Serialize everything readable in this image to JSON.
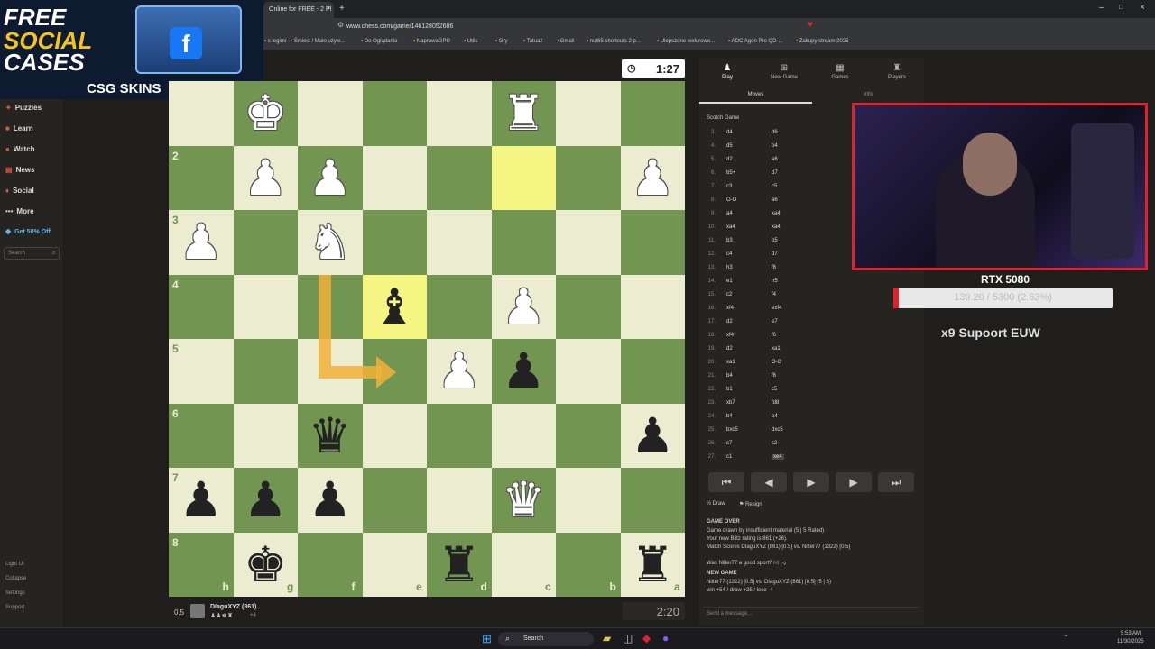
{
  "browser": {
    "tab_title": "Online for FREE - 2 Pl",
    "url": "www.chess.com/game/146128052686",
    "bookmarks": [
      "s legimi",
      "Śmieci / Mało używ...",
      "Do Oglądania",
      "NaprawaGPU",
      "Utils",
      "Gry",
      "Tatuaż",
      "Gmail",
      "nut65 shortcuts 2 p...",
      "Ulepszone wełurowe...",
      "AOC Agon Pro QD-...",
      "Zakupy stream 2025"
    ]
  },
  "promo": {
    "line1": "FREE",
    "line2": "SOCIAL",
    "line3": "CASES",
    "brand": "CSG SKINS",
    "box_label": "CSG SKINS"
  },
  "sidebar": {
    "items": [
      {
        "label": "Puzzles",
        "icon": "puzzle-icon"
      },
      {
        "label": "Learn",
        "icon": "learn-icon"
      },
      {
        "label": "Watch",
        "icon": "watch-icon"
      },
      {
        "label": "News",
        "icon": "news-icon"
      },
      {
        "label": "Social",
        "icon": "social-icon"
      },
      {
        "label": "More",
        "icon": "more-icon"
      },
      {
        "label": "Get 50% Off",
        "icon": "diamond-icon"
      }
    ],
    "search_placeholder": "Search",
    "bottom": [
      "Light UI",
      "Collapse",
      "Settings",
      "Support"
    ]
  },
  "board": {
    "rank_labels": [
      "2",
      "3",
      "4",
      "5",
      "6",
      "7",
      "8"
    ],
    "file_labels": [
      "h",
      "g",
      "f",
      "e",
      "d",
      "c",
      "b",
      "a"
    ],
    "pieces": [
      {
        "sq": [
          1,
          0
        ],
        "p": "♚",
        "c": "w"
      },
      {
        "sq": [
          5,
          0
        ],
        "p": "♜",
        "c": "w"
      },
      {
        "sq": [
          1,
          1
        ],
        "p": "♟",
        "c": "w"
      },
      {
        "sq": [
          2,
          1
        ],
        "p": "♟",
        "c": "w"
      },
      {
        "sq": [
          7,
          1
        ],
        "p": "♟",
        "c": "w"
      },
      {
        "sq": [
          0,
          2
        ],
        "p": "♟",
        "c": "w"
      },
      {
        "sq": [
          2,
          2
        ],
        "p": "♞",
        "c": "w"
      },
      {
        "sq": [
          3,
          3
        ],
        "p": "♝",
        "c": "b"
      },
      {
        "sq": [
          5,
          3
        ],
        "p": "♟",
        "c": "w"
      },
      {
        "sq": [
          4,
          4
        ],
        "p": "♟",
        "c": "w"
      },
      {
        "sq": [
          5,
          4
        ],
        "p": "♟",
        "c": "b"
      },
      {
        "sq": [
          2,
          5
        ],
        "p": "♛",
        "c": "b"
      },
      {
        "sq": [
          7,
          5
        ],
        "p": "♟",
        "c": "b"
      },
      {
        "sq": [
          0,
          6
        ],
        "p": "♟",
        "c": "b"
      },
      {
        "sq": [
          1,
          6
        ],
        "p": "♟",
        "c": "b"
      },
      {
        "sq": [
          2,
          6
        ],
        "p": "♟",
        "c": "b"
      },
      {
        "sq": [
          5,
          6
        ],
        "p": "♛",
        "c": "w"
      },
      {
        "sq": [
          1,
          7
        ],
        "p": "♚",
        "c": "b"
      },
      {
        "sq": [
          4,
          7
        ],
        "p": "♜",
        "c": "b"
      },
      {
        "sq": [
          7,
          7
        ],
        "p": "♜",
        "c": "b"
      }
    ],
    "highlights": [
      [
        5,
        1
      ],
      [
        3,
        3
      ]
    ]
  },
  "clock": {
    "top": "1:27",
    "bottom": "2:20"
  },
  "player_bottom": {
    "score": "0.5",
    "name": "DIaguXYZ (861)",
    "diff": "+4"
  },
  "panel": {
    "tabs": [
      {
        "label": "Play",
        "icon": "play-icon"
      },
      {
        "label": "New Game",
        "icon": "plus-icon"
      },
      {
        "label": "Games",
        "icon": "games-icon"
      },
      {
        "label": "Players",
        "icon": "players-icon"
      }
    ],
    "subtabs": [
      "Moves",
      "Info"
    ],
    "opening": "Scotch Game",
    "moves": [
      [
        "3.",
        "d4",
        "d6"
      ],
      [
        "4.",
        "d5",
        "b4"
      ],
      [
        "5.",
        "d2",
        "a6"
      ],
      [
        "6.",
        "b5+",
        "d7"
      ],
      [
        "7.",
        "c3",
        "c5"
      ],
      [
        "8.",
        "O-O",
        "a6"
      ],
      [
        "9.",
        "a4",
        "xa4"
      ],
      [
        "10.",
        "xa4",
        "xa4"
      ],
      [
        "11.",
        "b3",
        "b5"
      ],
      [
        "12.",
        "c4",
        "d7"
      ],
      [
        "13.",
        "h3",
        "f6"
      ],
      [
        "14.",
        "e1",
        "h5"
      ],
      [
        "15.",
        "c2",
        "f4"
      ],
      [
        "16.",
        "xf4",
        "exf4"
      ],
      [
        "17.",
        "d2",
        "e7"
      ],
      [
        "18.",
        "xf4",
        "f6"
      ],
      [
        "19.",
        "d2",
        "xa1"
      ],
      [
        "20.",
        "xa1",
        "O-O"
      ],
      [
        "21.",
        "b4",
        "f6"
      ],
      [
        "22.",
        "b1",
        "c5"
      ],
      [
        "23.",
        "xb7",
        "fd8"
      ],
      [
        "24.",
        "b4",
        "a4"
      ],
      [
        "25.",
        "bxc5",
        "dxc5"
      ],
      [
        "26.",
        "c7",
        "c2"
      ],
      [
        "27.",
        "c1",
        "xe4"
      ]
    ],
    "draw_label": "Draw",
    "resign_label": "Resign",
    "game_over_title": "GAME OVER",
    "game_over_lines": [
      "Game drawn by insufficient material (5 | 5 Rated)",
      "Your new Blitz rating is 861 (+26).",
      "Match Scores DIaguXYZ (861) [0.5] vs. Nilter77 (1322) [0.5]"
    ],
    "sportsmanship": "Was Nilter77 a good sport?",
    "new_game_title": "NEW GAME",
    "new_game_lines": [
      "Nilter77 (1322) [0.5] vs. DIaguXYZ (861) [0.5] (5 | 5)",
      "win +54 / draw +25 / lose -4"
    ],
    "chat_placeholder": "Send a message..."
  },
  "overlay": {
    "gpu_name": "RTX 5080",
    "gpu_stat": "139.20 / 5300 (2.63%)",
    "support_text": "x9 Supoort  EUW"
  },
  "taskbar": {
    "search": "Search",
    "time": "5:53 AM",
    "date": "11/30/2025"
  }
}
